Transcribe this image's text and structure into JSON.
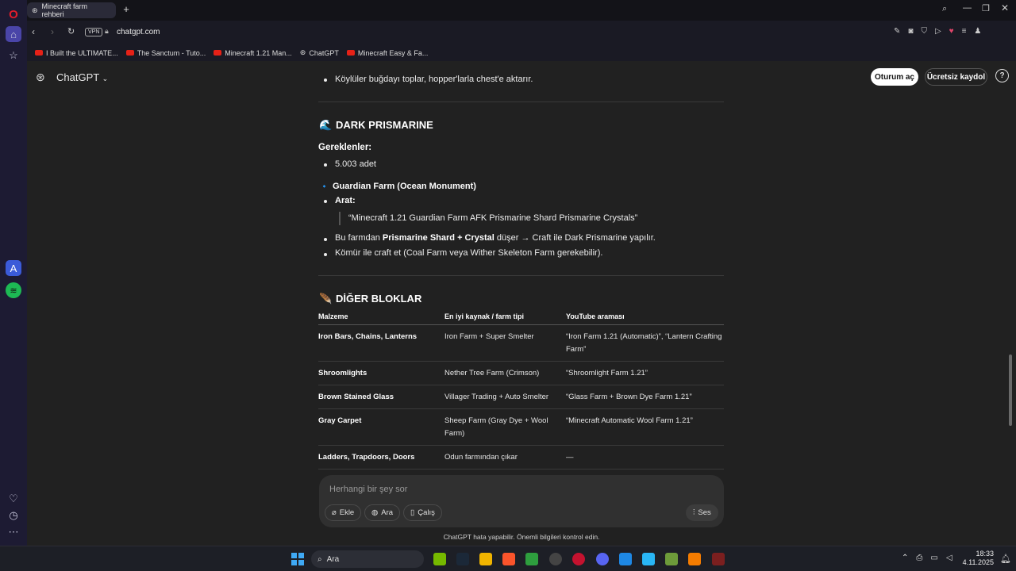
{
  "browser": {
    "tab_title": "Minecraft farm rehberi",
    "url": "chatgpt.com",
    "vpn": "VPN",
    "bookmarks": [
      "I Built the ULTIMATE...",
      "The Sanctum - Tuto...",
      "Minecraft 1.21 Man...",
      "ChatGPT",
      "Minecraft Easy & Fa..."
    ]
  },
  "header": {
    "brand": "ChatGPT",
    "login": "Oturum aç",
    "signup": "Ücretsiz kaydol",
    "help": "?"
  },
  "content": {
    "prev_bullet": "Köylüler buğdayı toplar, hopper'larla chest'e aktarır.",
    "dp_emoji": "🌊",
    "dp_title": "DARK PRISMARINE",
    "req_label": "Gereklenler:",
    "req_item": "5.003 adet",
    "farm_icon": "🔹",
    "farm_title": "Guardian Farm (Ocean Monument)",
    "search_label": "Arat:",
    "search_quote": "“Minecraft 1.21 Guardian Farm AFK Prismarine Shard Prismarine Crystals”",
    "b1_pre": "Bu farmdan ",
    "b1_bold": "Prismarine Shard + Crystal",
    "b1_post": " düşer → Craft ile Dark Prismarine yapılır.",
    "b2": "Kömür ile craft et (Coal Farm veya Wither Skeleton Farm gerekebilir).",
    "ob_emoji": "🪶",
    "ob_title": "DİĞER BLOKLAR",
    "table": {
      "headers": [
        "Malzeme",
        "En iyi kaynak / farm tipi",
        "YouTube araması"
      ],
      "rows": [
        [
          "Iron Bars, Chains, Lanterns",
          "Iron Farm + Super Smelter",
          "“Iron Farm 1.21 (Automatic)”, “Lantern Crafting Farm”"
        ],
        [
          "Shroomlights",
          "Nether Tree Farm (Crimson)",
          "“Shroomlight Farm 1.21”"
        ],
        [
          "Brown Stained Glass",
          "Villager Trading + Auto Smelter",
          "“Glass Farm + Brown Dye Farm 1.21”"
        ],
        [
          "Gray Carpet",
          "Sheep Farm (Gray Dye + Wool Farm)",
          "“Minecraft Automatic Wool Farm 1.21”"
        ],
        [
          "Ladders, Trapdoors, Doors",
          "Odun farmından çıkar",
          "—"
        ]
      ]
    }
  },
  "composer": {
    "placeholder": "Herhangi bir şey sor",
    "attach": "Ekle",
    "search": "Ara",
    "study": "Çalış",
    "voice": "Ses"
  },
  "footer_note": "ChatGPT hata yapabilir. Önemli bilgileri kontrol edin.",
  "taskbar": {
    "search": "Ara",
    "time": "18:33",
    "date": "4.11.2025"
  },
  "colors": {
    "page_bg": "#212121",
    "sidebar_bg": "#1d1b33",
    "accent": "#2f6fe4"
  }
}
